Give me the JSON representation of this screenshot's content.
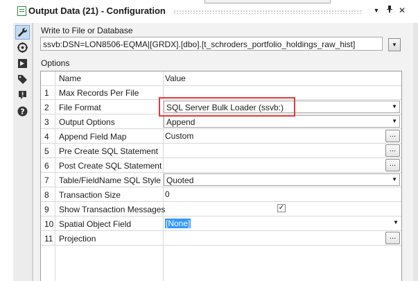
{
  "window": {
    "title": "Output Data (21) - Configuration",
    "controls": {
      "menu": "▼",
      "pin": "ᵖ",
      "close": "✕"
    }
  },
  "sidebar": {
    "items": [
      {
        "icon": "wrench-icon",
        "active": true
      },
      {
        "icon": "target-icon",
        "active": false
      },
      {
        "icon": "arrow-in-icon",
        "active": false
      },
      {
        "icon": "tag-icon",
        "active": false
      },
      {
        "icon": "warning-icon",
        "active": false
      },
      {
        "icon": "help-icon",
        "active": false
      }
    ]
  },
  "config": {
    "write_label": "Write to File or Database",
    "connection": "ssvb:DSN=LON8506-EQMA|[GRDX].[dbo].[t_schroders_portfolio_holdings_raw_hist]",
    "options_label": "Options",
    "columns": {
      "name": "Name",
      "value": "Value"
    },
    "rows": [
      {
        "num": "1",
        "name": "Max Records Per File",
        "value": ""
      },
      {
        "num": "2",
        "name": "File Format",
        "value": "SQL Server Bulk Loader (ssvb:)"
      },
      {
        "num": "3",
        "name": "Output Options",
        "value": "Append"
      },
      {
        "num": "4",
        "name": "Append Field Map",
        "value": "Custom"
      },
      {
        "num": "5",
        "name": "Pre Create SQL Statement",
        "value": ""
      },
      {
        "num": "6",
        "name": "Post Create SQL Statement",
        "value": ""
      },
      {
        "num": "7",
        "name": "Table/FieldName SQL Style",
        "value": "Quoted"
      },
      {
        "num": "8",
        "name": "Transaction Size",
        "value": "0"
      },
      {
        "num": "9",
        "name": "Show Transaction Messages",
        "value": "✓"
      },
      {
        "num": "10",
        "name": "Spatial Object Field",
        "value": "[None]"
      },
      {
        "num": "11",
        "name": "Projection",
        "value": ""
      }
    ],
    "ellipsis": "...",
    "dropdown_arrow": "▼"
  },
  "colors": {
    "highlight": "#e0393e",
    "selection": "#3399ff",
    "active_tool": "#c3dcf3"
  }
}
